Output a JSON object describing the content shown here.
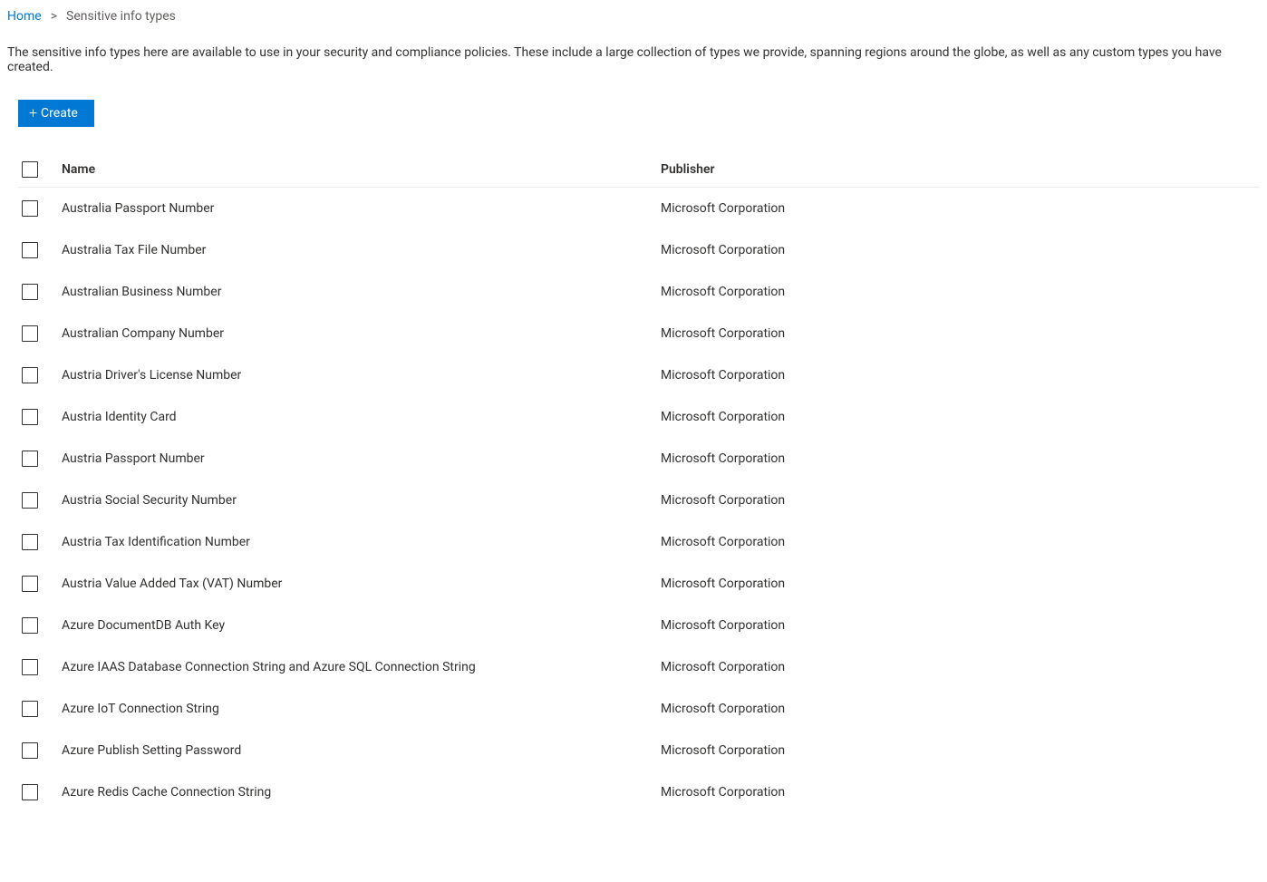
{
  "breadcrumb": {
    "home_label": "Home",
    "separator": ">",
    "current": "Sensitive info types"
  },
  "description": "The sensitive info types here are available to use in your security and compliance policies. These include a large collection of types we provide, spanning regions around the globe, as well as any custom types you have created.",
  "toolbar": {
    "create_label": "Create"
  },
  "table": {
    "columns": {
      "name": "Name",
      "publisher": "Publisher"
    },
    "rows": [
      {
        "name": "Australia Passport Number",
        "publisher": "Microsoft Corporation"
      },
      {
        "name": "Australia Tax File Number",
        "publisher": "Microsoft Corporation"
      },
      {
        "name": "Australian Business Number",
        "publisher": "Microsoft Corporation"
      },
      {
        "name": "Australian Company Number",
        "publisher": "Microsoft Corporation"
      },
      {
        "name": "Austria Driver's License Number",
        "publisher": "Microsoft Corporation"
      },
      {
        "name": "Austria Identity Card",
        "publisher": "Microsoft Corporation"
      },
      {
        "name": "Austria Passport Number",
        "publisher": "Microsoft Corporation"
      },
      {
        "name": "Austria Social Security Number",
        "publisher": "Microsoft Corporation"
      },
      {
        "name": "Austria Tax Identification Number",
        "publisher": "Microsoft Corporation"
      },
      {
        "name": "Austria Value Added Tax (VAT) Number",
        "publisher": "Microsoft Corporation"
      },
      {
        "name": "Azure DocumentDB Auth Key",
        "publisher": "Microsoft Corporation"
      },
      {
        "name": "Azure IAAS Database Connection String and Azure SQL Connection String",
        "publisher": "Microsoft Corporation"
      },
      {
        "name": "Azure IoT Connection String",
        "publisher": "Microsoft Corporation"
      },
      {
        "name": "Azure Publish Setting Password",
        "publisher": "Microsoft Corporation"
      },
      {
        "name": "Azure Redis Cache Connection String",
        "publisher": "Microsoft Corporation"
      }
    ]
  }
}
